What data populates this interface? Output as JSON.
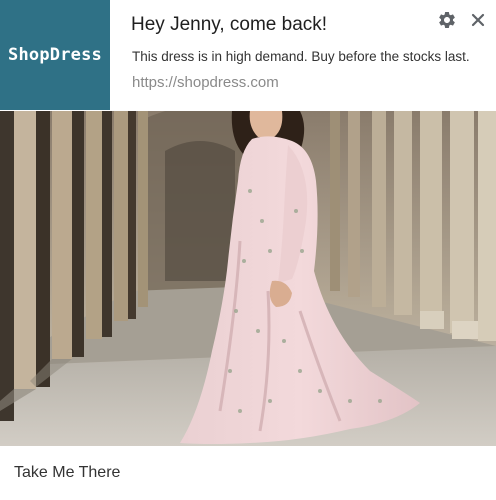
{
  "notification": {
    "logo_text": "ShopDress",
    "title": "Hey Jenny, come back!",
    "message": "This dress is in high demand.  Buy before the stocks last.",
    "url": "https://shopdress.com",
    "settings_icon": "gear-icon",
    "close_icon": "close-icon",
    "action_label": "Take Me There"
  },
  "colors": {
    "brand": "#2f7186",
    "title_text": "#1f1f1f",
    "secondary_text": "#8a8a8a",
    "dress": "#f1d3d6"
  }
}
